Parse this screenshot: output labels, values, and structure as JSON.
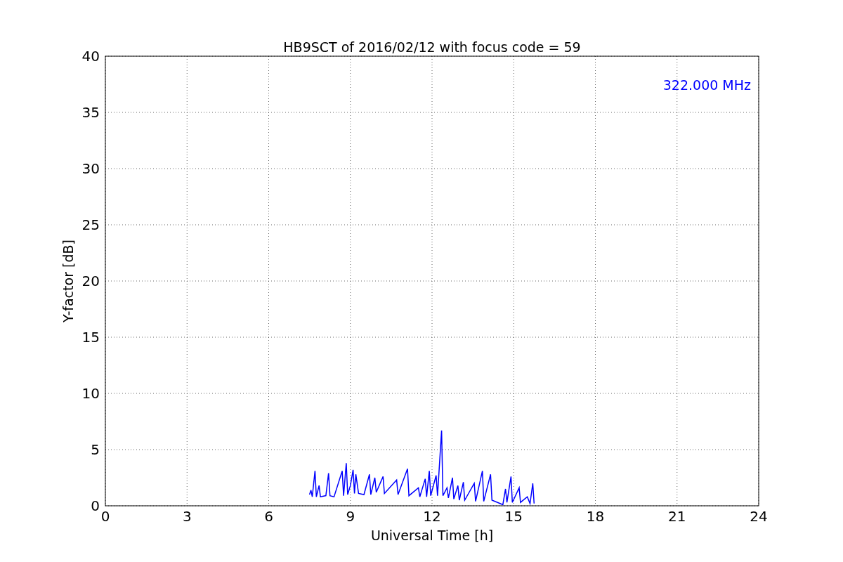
{
  "chart": {
    "chart_data": {
      "type": "line",
      "title": "HB9SCT of 2016/02/12 with focus code = 59",
      "xlabel": "Universal Time [h]",
      "ylabel": "Y-factor [dB]",
      "x": [
        7.5,
        7.55,
        7.6,
        7.7,
        7.75,
        7.85,
        7.9,
        8.1,
        8.2,
        8.25,
        8.4,
        8.7,
        8.75,
        8.85,
        8.9,
        9.0,
        9.1,
        9.15,
        9.2,
        9.3,
        9.5,
        9.7,
        9.75,
        9.9,
        9.95,
        10.2,
        10.25,
        10.7,
        10.75,
        11.1,
        11.15,
        11.5,
        11.55,
        11.75,
        11.8,
        11.9,
        11.95,
        12.15,
        12.2,
        12.35,
        12.4,
        12.55,
        12.6,
        12.75,
        12.8,
        12.95,
        13.0,
        13.15,
        13.2,
        13.55,
        13.6,
        13.85,
        13.9,
        14.15,
        14.2,
        14.5,
        14.6,
        14.7,
        14.75,
        14.9,
        14.95,
        15.2,
        15.25,
        15.5,
        15.6,
        15.7,
        15.75
      ],
      "series": [
        {
          "name": "322.000 MHz",
          "color": "#0000ff",
          "values": [
            1.0,
            1.4,
            0.8,
            3.1,
            0.8,
            1.8,
            0.8,
            0.9,
            2.9,
            0.9,
            0.8,
            3.1,
            0.9,
            3.8,
            1.0,
            1.8,
            3.2,
            1.1,
            2.8,
            1.1,
            1.0,
            2.8,
            1.0,
            2.5,
            1.2,
            2.6,
            1.1,
            2.3,
            1.0,
            3.3,
            0.9,
            1.6,
            0.8,
            2.4,
            0.8,
            3.1,
            0.9,
            2.7,
            0.9,
            6.7,
            0.9,
            1.6,
            0.7,
            2.5,
            0.6,
            1.8,
            0.5,
            2.1,
            0.5,
            2.0,
            0.4,
            3.1,
            0.4,
            2.8,
            0.5,
            0.2,
            0.1,
            1.5,
            0.3,
            2.6,
            0.3,
            1.6,
            0.3,
            0.8,
            0.2,
            2.0,
            0.2
          ]
        }
      ],
      "xlim": [
        0,
        24
      ],
      "ylim": [
        0,
        40
      ],
      "xticks": [
        0,
        3,
        6,
        9,
        12,
        15,
        18,
        21,
        24
      ],
      "yticks": [
        0,
        5,
        10,
        15,
        20,
        25,
        30,
        35,
        40
      ],
      "grid": true
    }
  }
}
